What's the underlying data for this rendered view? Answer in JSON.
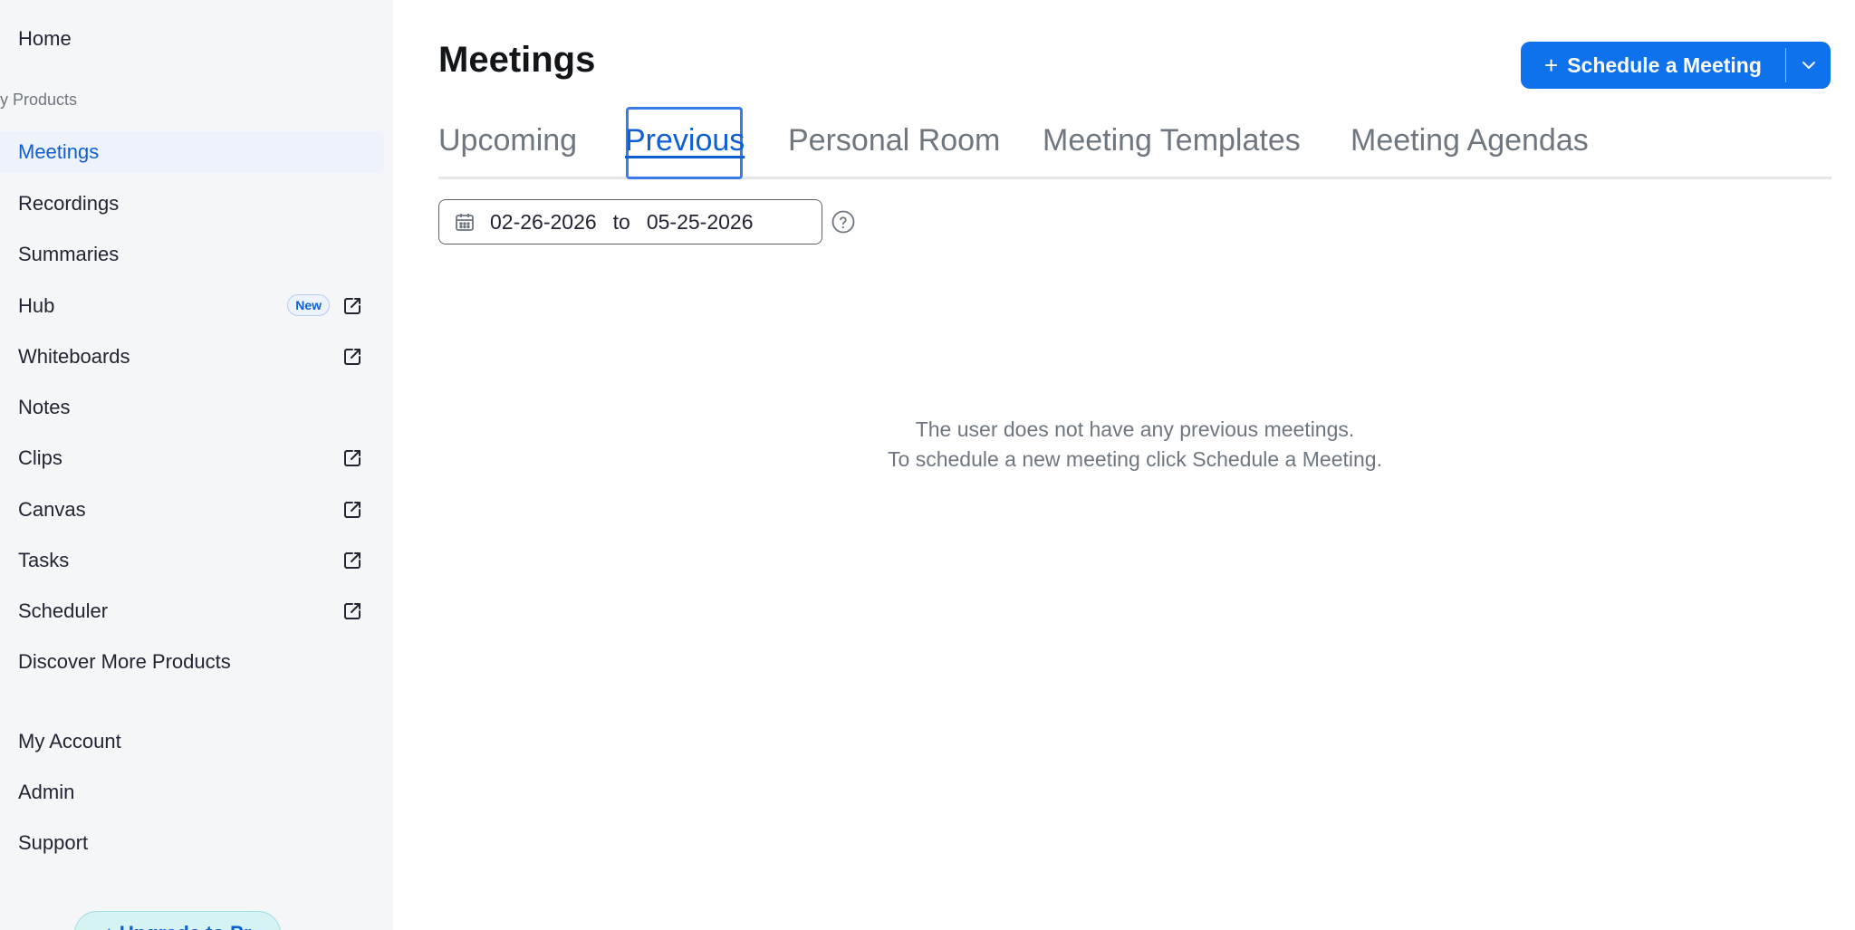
{
  "sidebar": {
    "home_label": "Home",
    "section_label": "y Products",
    "items": [
      {
        "label": "Meetings"
      },
      {
        "label": "Recordings"
      },
      {
        "label": "Summaries"
      },
      {
        "label": "Hub",
        "badge": "New"
      },
      {
        "label": "Whiteboards"
      },
      {
        "label": "Notes"
      },
      {
        "label": "Clips"
      },
      {
        "label": "Canvas"
      },
      {
        "label": "Tasks"
      },
      {
        "label": "Scheduler"
      },
      {
        "label": "Discover More Products"
      }
    ],
    "account_items": [
      {
        "label": "My Account"
      },
      {
        "label": "Admin"
      },
      {
        "label": "Support"
      }
    ],
    "upgrade_label": "↑ Upgrade to Pr"
  },
  "main": {
    "title": "Meetings",
    "schedule_button": {
      "plus": "+",
      "label": "Schedule a Meeting"
    },
    "tabs": [
      {
        "label": "Upcoming"
      },
      {
        "label": "Previous"
      },
      {
        "label": "Personal Room"
      },
      {
        "label": "Meeting Templates"
      },
      {
        "label": "Meeting Agendas"
      }
    ],
    "date_range": {
      "from": "02-26-2026",
      "to_label": "to",
      "to": "05-25-2026"
    },
    "empty_state": {
      "line1": "The user does not have any previous meetings.",
      "line2": "To schedule a new meeting click Schedule a Meeting."
    }
  },
  "colors": {
    "accent": "#0e72ed",
    "active_text": "#0e5fd4",
    "sidebar_bg": "#f5f6f8"
  }
}
